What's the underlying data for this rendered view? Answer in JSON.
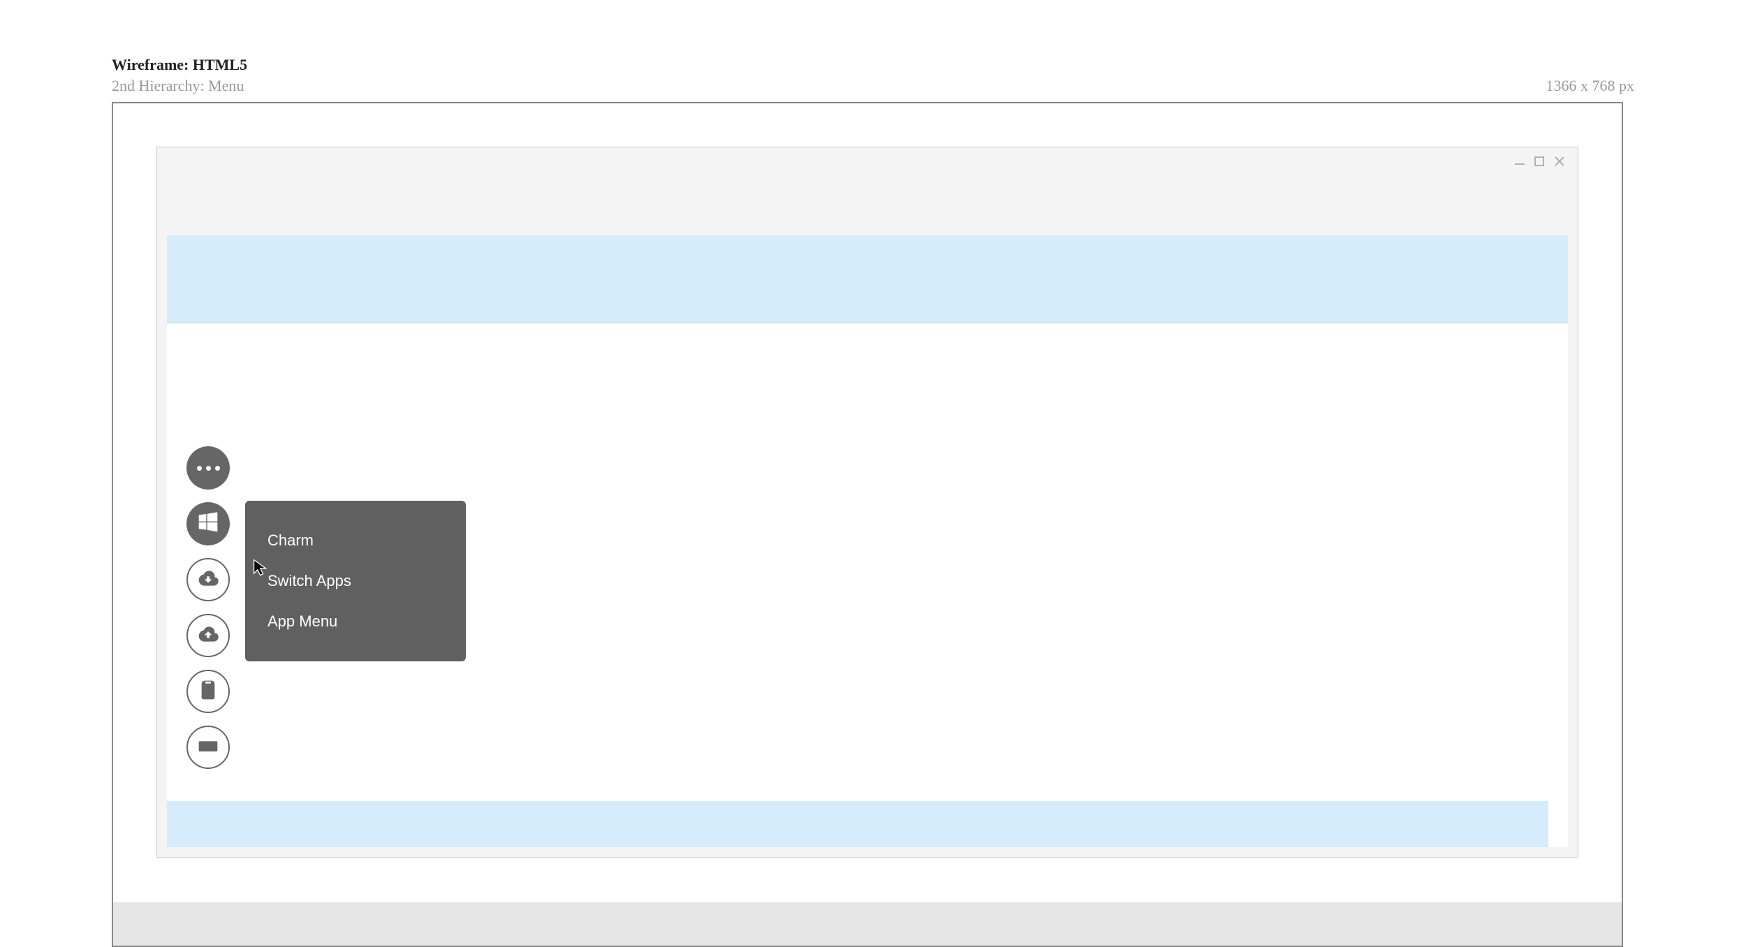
{
  "meta": {
    "title": "Wireframe: HTML5",
    "hierarchy": "2nd Hierarchy: Menu",
    "dimensions": "1366 x 768 px"
  },
  "toolbar": {
    "icons": [
      "more",
      "windows",
      "cloud-download",
      "cloud-upload",
      "clipboard",
      "keyboard"
    ]
  },
  "menu": {
    "items": [
      "Charm",
      "Switch Apps",
      "App Menu"
    ]
  }
}
